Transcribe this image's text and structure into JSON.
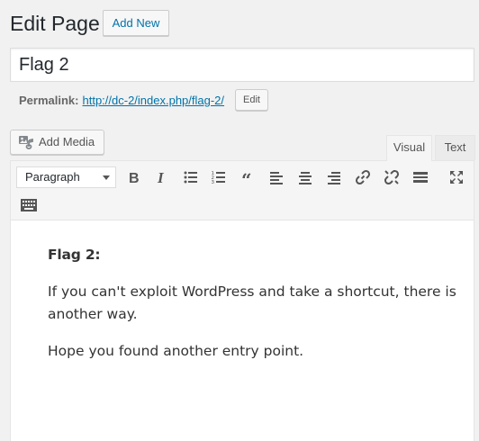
{
  "header": {
    "title": "Edit Page",
    "add_new_label": "Add New"
  },
  "post": {
    "title_value": "Flag 2"
  },
  "permalink": {
    "label": "Permalink:",
    "url": "http://dc-2/index.php/flag-2/",
    "edit_label": "Edit"
  },
  "media": {
    "add_media_label": "Add Media"
  },
  "editor_tabs": {
    "visual": "Visual",
    "text": "Text"
  },
  "toolbar": {
    "format_value": "Paragraph",
    "icons": [
      "bold-icon",
      "italic-icon",
      "bullet-list-icon",
      "numbered-list-icon",
      "blockquote-icon",
      "align-left-icon",
      "align-center-icon",
      "align-right-icon",
      "link-icon",
      "unlink-icon",
      "read-more-icon",
      "fullscreen-icon",
      "toolbar-toggle-icon"
    ]
  },
  "content": {
    "heading": "Flag 2:",
    "paragraphs": [
      "If you can't exploit WordPress and take a shortcut, there is another way.",
      "Hope you found another entry point."
    ]
  }
}
